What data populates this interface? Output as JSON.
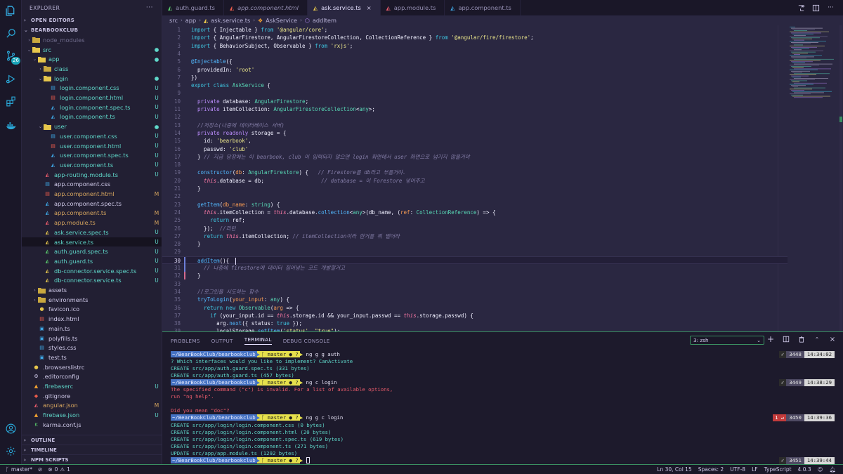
{
  "activity_bar": {
    "items": [
      "explorer-icon",
      "search-icon",
      "source-control-icon",
      "run-debug-icon",
      "extensions-icon",
      "docker-icon"
    ],
    "source_control_badge": "26",
    "bottom": [
      "account-icon",
      "settings-gear-icon"
    ]
  },
  "sidebar": {
    "title": "EXPLORER",
    "more": "···",
    "open_editors": "OPEN EDITORS",
    "project": "BEARBOOKCLUB",
    "tree": [
      {
        "name": "node_modules",
        "indent": 1,
        "type": "folder",
        "twisty": "›",
        "status": "",
        "color": "#6e6a8a",
        "icon": "folder-icon"
      },
      {
        "name": "src",
        "indent": 1,
        "type": "folder",
        "twisty": "⌄",
        "status": "●",
        "color": "#5fd7c9",
        "icon": "folder-open-icon"
      },
      {
        "name": "app",
        "indent": 2,
        "type": "folder",
        "twisty": "⌄",
        "status": "●",
        "color": "#5fd7c9",
        "icon": "folder-open-icon"
      },
      {
        "name": "class",
        "indent": 3,
        "type": "folder",
        "twisty": "›",
        "status": "",
        "color": "#5fd7c9",
        "icon": "folder-icon"
      },
      {
        "name": "login",
        "indent": 3,
        "type": "folder",
        "twisty": "⌄",
        "status": "●",
        "color": "#5fd7c9",
        "icon": "folder-open-icon"
      },
      {
        "name": "login.component.css",
        "indent": 4,
        "type": "css",
        "status": "U",
        "color": "#5fd7c9",
        "icon": "css-file-icon"
      },
      {
        "name": "login.component.html",
        "indent": 4,
        "type": "html",
        "status": "U",
        "color": "#5fd7c9",
        "icon": "html-file-icon"
      },
      {
        "name": "login.component.spec.ts",
        "indent": 4,
        "type": "spec",
        "status": "U",
        "color": "#5fd7c9",
        "icon": "angular-spec-icon"
      },
      {
        "name": "login.component.ts",
        "indent": 4,
        "type": "ts",
        "status": "U",
        "color": "#5fd7c9",
        "icon": "angular-ts-icon"
      },
      {
        "name": "user",
        "indent": 3,
        "type": "folder",
        "twisty": "⌄",
        "status": "●",
        "color": "#5fd7c9",
        "icon": "folder-open-icon"
      },
      {
        "name": "user.component.css",
        "indent": 4,
        "type": "css",
        "status": "U",
        "color": "#5fd7c9",
        "icon": "css-file-icon"
      },
      {
        "name": "user.component.html",
        "indent": 4,
        "type": "html",
        "status": "U",
        "color": "#5fd7c9",
        "icon": "html-file-icon"
      },
      {
        "name": "user.component.spec.ts",
        "indent": 4,
        "type": "spec",
        "status": "U",
        "color": "#5fd7c9",
        "icon": "angular-spec-icon"
      },
      {
        "name": "user.component.ts",
        "indent": 4,
        "type": "ts",
        "status": "U",
        "color": "#5fd7c9",
        "icon": "angular-ts-icon"
      },
      {
        "name": "app-routing.module.ts",
        "indent": 3,
        "type": "mod",
        "status": "U",
        "color": "#5fd7c9",
        "icon": "angular-module-icon"
      },
      {
        "name": "app.component.css",
        "indent": 3,
        "type": "css",
        "status": "",
        "color": "#cfc9e8",
        "icon": "css-file-icon"
      },
      {
        "name": "app.component.html",
        "indent": 3,
        "type": "html",
        "status": "M",
        "color": "#d7a65f",
        "icon": "html-file-icon"
      },
      {
        "name": "app.component.spec.ts",
        "indent": 3,
        "type": "spec",
        "status": "",
        "color": "#cfc9e8",
        "icon": "angular-spec-icon"
      },
      {
        "name": "app.component.ts",
        "indent": 3,
        "type": "ts",
        "status": "M",
        "color": "#d7a65f",
        "icon": "angular-ts-icon"
      },
      {
        "name": "app.module.ts",
        "indent": 3,
        "type": "mod",
        "status": "M",
        "color": "#d7a65f",
        "icon": "angular-module-icon"
      },
      {
        "name": "ask.service.spec.ts",
        "indent": 3,
        "type": "svcspec",
        "status": "U",
        "color": "#5fd7c9",
        "icon": "service-spec-icon"
      },
      {
        "name": "ask.service.ts",
        "indent": 3,
        "type": "svc",
        "status": "U",
        "color": "#5fd7c9",
        "icon": "service-file-icon",
        "selected": true
      },
      {
        "name": "auth.guard.spec.ts",
        "indent": 3,
        "type": "guard",
        "status": "U",
        "color": "#5fd7c9",
        "icon": "guard-spec-icon"
      },
      {
        "name": "auth.guard.ts",
        "indent": 3,
        "type": "guard",
        "status": "U",
        "color": "#5fd7c9",
        "icon": "guard-file-icon"
      },
      {
        "name": "db-connector.service.spec.ts",
        "indent": 3,
        "type": "svcspec",
        "status": "U",
        "color": "#5fd7c9",
        "icon": "service-spec-icon"
      },
      {
        "name": "db-connector.service.ts",
        "indent": 3,
        "type": "svc",
        "status": "U",
        "color": "#5fd7c9",
        "icon": "service-file-icon"
      },
      {
        "name": "assets",
        "indent": 2,
        "type": "folder",
        "twisty": "›",
        "status": "",
        "color": "#cfc9e8",
        "icon": "folder-icon"
      },
      {
        "name": "environments",
        "indent": 2,
        "type": "folder",
        "twisty": "›",
        "status": "",
        "color": "#cfc9e8",
        "icon": "folder-icon"
      },
      {
        "name": "favicon.ico",
        "indent": 2,
        "type": "fav",
        "status": "",
        "color": "#cfc9e8",
        "icon": "favicon-file-icon"
      },
      {
        "name": "index.html",
        "indent": 2,
        "type": "html",
        "status": "",
        "color": "#cfc9e8",
        "icon": "html-file-icon"
      },
      {
        "name": "main.ts",
        "indent": 2,
        "type": "tsplain",
        "status": "",
        "color": "#cfc9e8",
        "icon": "typescript-file-icon"
      },
      {
        "name": "polyfills.ts",
        "indent": 2,
        "type": "tsplain",
        "status": "",
        "color": "#cfc9e8",
        "icon": "typescript-file-icon"
      },
      {
        "name": "styles.css",
        "indent": 2,
        "type": "css",
        "status": "",
        "color": "#cfc9e8",
        "icon": "css-file-icon"
      },
      {
        "name": "test.ts",
        "indent": 2,
        "type": "tsplain",
        "status": "",
        "color": "#cfc9e8",
        "icon": "typescript-file-icon"
      },
      {
        "name": ".browserslistrc",
        "indent": 1,
        "type": "dot",
        "status": "",
        "color": "#cfc9e8",
        "icon": "browserslist-file-icon"
      },
      {
        "name": ".editorconfig",
        "indent": 1,
        "type": "gear",
        "status": "",
        "color": "#cfc9e8",
        "icon": "editorconfig-file-icon"
      },
      {
        "name": ".firebaserc",
        "indent": 1,
        "type": "fire",
        "status": "U",
        "color": "#5fd7c9",
        "icon": "firebase-file-icon"
      },
      {
        "name": ".gitignore",
        "indent": 1,
        "type": "git",
        "status": "",
        "color": "#cfc9e8",
        "icon": "git-file-icon"
      },
      {
        "name": "angular.json",
        "indent": 1,
        "type": "ang",
        "status": "M",
        "color": "#d7a65f",
        "icon": "angular-json-icon"
      },
      {
        "name": "firebase.json",
        "indent": 1,
        "type": "fire",
        "status": "U",
        "color": "#5fd7c9",
        "icon": "firebase-file-icon"
      },
      {
        "name": "karma.conf.js",
        "indent": 1,
        "type": "karma",
        "status": "",
        "color": "#cfc9e8",
        "icon": "karma-file-icon"
      }
    ],
    "outline": "OUTLINE",
    "timeline": "TIMELINE",
    "npm_scripts": "NPM SCRIPTS"
  },
  "tabs": [
    {
      "label": "auth.guard.ts",
      "italic": false,
      "active": false,
      "icon": "guard-file-icon",
      "icolor": "#58c76b"
    },
    {
      "label": "app.component.html",
      "italic": true,
      "active": false,
      "icon": "html-file-icon",
      "icolor": "#ec5c4c"
    },
    {
      "label": "ask.service.ts",
      "italic": false,
      "active": true,
      "icon": "service-file-icon",
      "icolor": "#e6c64c",
      "close": "×"
    },
    {
      "label": "app.module.ts",
      "italic": false,
      "active": false,
      "icon": "angular-module-icon",
      "icolor": "#ec5c6c"
    },
    {
      "label": "app.component.ts",
      "italic": false,
      "active": false,
      "icon": "angular-ts-icon",
      "icolor": "#3ea7e6"
    }
  ],
  "breadcrumb": [
    "src",
    "app",
    "ask.service.ts",
    "AskService",
    "addItem"
  ],
  "editor": {
    "current_line": 30,
    "lines": [
      [
        [
          "kw",
          "import"
        ],
        [
          "pr",
          " { Injectable } "
        ],
        [
          "kw",
          "from"
        ],
        [
          "st2",
          " '@angular/core'"
        ],
        [
          "pr",
          ";"
        ]
      ],
      [
        [
          "kw",
          "import"
        ],
        [
          "pr",
          " { AngularFirestore, AngularFirestoreCollection, CollectionReference } "
        ],
        [
          "kw",
          "from"
        ],
        [
          "st2",
          " '@angular/fire/firestore'"
        ],
        [
          "pr",
          ";"
        ]
      ],
      [
        [
          "kw",
          "import"
        ],
        [
          "pr",
          " { BehaviorSubject, Observable } "
        ],
        [
          "kw",
          "from"
        ],
        [
          "st2",
          " 'rxjs'"
        ],
        [
          "pr",
          ";"
        ]
      ],
      [],
      [
        [
          "fn",
          "@Injectable"
        ],
        [
          "pr",
          "({"
        ]
      ],
      [
        [
          "pr",
          "  providedIn: "
        ],
        [
          "st2",
          "'root'"
        ]
      ],
      [
        [
          "pr",
          "})"
        ]
      ],
      [
        [
          "kw",
          "export class "
        ],
        [
          "ty",
          "AskService"
        ],
        [
          "pr",
          " {"
        ]
      ],
      [],
      [
        [
          "kp",
          "  private "
        ],
        [
          "pr",
          "database: "
        ],
        [
          "ty",
          "AngularFirestore"
        ],
        [
          "pr",
          ";"
        ]
      ],
      [
        [
          "kp",
          "  private "
        ],
        [
          "pr",
          "itemCollection: "
        ],
        [
          "ty",
          "AngularFirestoreCollection"
        ],
        [
          "pr",
          "<"
        ],
        [
          "ty",
          "any"
        ],
        [
          "pr",
          ">;"
        ]
      ],
      [],
      [
        [
          "cm",
          "  //저장소(나중에 데이터베이스 서버)"
        ]
      ],
      [
        [
          "kp",
          "  private readonly "
        ],
        [
          "pr",
          "storage = {"
        ]
      ],
      [
        [
          "pr",
          "    id: "
        ],
        [
          "st2",
          "'bearbook'"
        ],
        [
          "pr",
          ","
        ]
      ],
      [
        [
          "pr",
          "    passwd: "
        ],
        [
          "st2",
          "'club'"
        ]
      ],
      [
        [
          "pr",
          "  } "
        ],
        [
          "cm",
          "// 지금 당장에는 이 bearbook, club 이 입력되지 않으면 login 화면에서 user 화면으로 넘기지 않을거야"
        ]
      ],
      [],
      [
        [
          "fn",
          "  constructor"
        ],
        [
          "pr",
          "("
        ],
        [
          "pa",
          "db"
        ],
        [
          "pr",
          ": "
        ],
        [
          "ty",
          "AngularFirestore"
        ],
        [
          "pr",
          ") {   "
        ],
        [
          "cm",
          "// Firestore를 db라고 부를거야."
        ]
      ],
      [
        [
          "th",
          "    this"
        ],
        [
          "pr",
          ".database = db;                  "
        ],
        [
          "cm",
          "// database = 이 Forestore 넣어주고"
        ]
      ],
      [
        [
          "pr",
          "  }"
        ]
      ],
      [],
      [
        [
          "fn",
          "  getItem"
        ],
        [
          "pr",
          "("
        ],
        [
          "pa",
          "db_name"
        ],
        [
          "pr",
          ": "
        ],
        [
          "ty",
          "string"
        ],
        [
          "pr",
          ") {"
        ]
      ],
      [
        [
          "th",
          "    this"
        ],
        [
          "pr",
          ".itemCollection = "
        ],
        [
          "th",
          "this"
        ],
        [
          "pr",
          ".database."
        ],
        [
          "fn",
          "collection"
        ],
        [
          "pr",
          "<"
        ],
        [
          "ty",
          "any"
        ],
        [
          "pr",
          ">(db_name, ("
        ],
        [
          "pa",
          "ref"
        ],
        [
          "pr",
          ": "
        ],
        [
          "ty",
          "CollectionReference"
        ],
        [
          "pr",
          ") => {"
        ]
      ],
      [
        [
          "kw",
          "      return "
        ],
        [
          "pr",
          "ref;"
        ]
      ],
      [
        [
          "pr",
          "    });  "
        ],
        [
          "cm",
          "//리턴"
        ]
      ],
      [
        [
          "kw",
          "    return "
        ],
        [
          "th",
          "this"
        ],
        [
          "pr",
          ".itemCollection; "
        ],
        [
          "cm",
          "// itemCollection이라 한거를 뭐 뱉어라"
        ]
      ],
      [
        [
          "pr",
          "  }"
        ]
      ],
      [],
      [
        [
          "fn",
          "  addItem"
        ],
        [
          "pr",
          "(){  "
        ]
      ],
      [
        [
          "cm",
          "    // 나중에 firestore에 데이터 집어넣는 코드 개발할거고"
        ]
      ],
      [
        [
          "pr",
          "  }"
        ]
      ],
      [],
      [
        [
          "cm",
          "  //로그인을 시도하는 함수"
        ]
      ],
      [
        [
          "fn",
          "  tryToLogin"
        ],
        [
          "pr",
          "("
        ],
        [
          "pa",
          "your_input"
        ],
        [
          "pr",
          ": "
        ],
        [
          "ty",
          "any"
        ],
        [
          "pr",
          ") {"
        ]
      ],
      [
        [
          "kw",
          "    return new "
        ],
        [
          "ty",
          "Observable"
        ],
        [
          "pr",
          "("
        ],
        [
          "pa",
          "arg"
        ],
        [
          "pr",
          " => {"
        ]
      ],
      [
        [
          "kw",
          "      if "
        ],
        [
          "pr",
          "(your_input.id == "
        ],
        [
          "th",
          "this"
        ],
        [
          "pr",
          ".storage.id && your_input.passwd == "
        ],
        [
          "th",
          "this"
        ],
        [
          "pr",
          ".storage.passwd) {"
        ]
      ],
      [
        [
          "pr",
          "        arg."
        ],
        [
          "fn",
          "next"
        ],
        [
          "pr",
          "({ status: "
        ],
        [
          "kw",
          "true"
        ],
        [
          "pr",
          " });"
        ]
      ],
      [
        [
          "pr",
          "        localStorage."
        ],
        [
          "fn",
          "setItem"
        ],
        [
          "pr",
          "("
        ],
        [
          "st2",
          "'status'"
        ],
        [
          "pr",
          ", "
        ],
        [
          "st2",
          "\"true\""
        ],
        [
          "pr",
          ");"
        ]
      ]
    ]
  },
  "panel": {
    "tabs": [
      "PROBLEMS",
      "OUTPUT",
      "TERMINAL",
      "DEBUG CONSOLE"
    ],
    "active": "TERMINAL",
    "shell": "3: zsh",
    "lines": [
      {
        "type": "prompt",
        "path": "~/BearBookClub/bearbookclub",
        "git": "ᚴ master ● ?",
        "cmd": "ng g g auth",
        "status": "✓",
        "count": "3448",
        "time": "14:34:02"
      },
      {
        "type": "out",
        "cls": "t-cyan",
        "text": "? Which interfaces would you like to implement? CanActivate"
      },
      {
        "type": "out",
        "cls": "t-cyan",
        "text": "CREATE src/app/auth.guard.spec.ts (331 bytes)"
      },
      {
        "type": "out",
        "cls": "t-cyan",
        "text": "CREATE src/app/auth.guard.ts (457 bytes)"
      },
      {
        "type": "prompt",
        "path": "~/BearBookClub/bearbookclub",
        "git": "ᚴ master ● ?",
        "cmd": "ng c login",
        "status": "✓",
        "count": "3449",
        "time": "14:38:29"
      },
      {
        "type": "out",
        "cls": "t-red",
        "text": "The specified command (\"c\") is invalid. For a list of available options,"
      },
      {
        "type": "out",
        "cls": "t-red",
        "text": "run \"ng help\"."
      },
      {
        "type": "out",
        "cls": "t-red",
        "text": ""
      },
      {
        "type": "out",
        "cls": "t-red",
        "text": "Did you mean \"doc\"?"
      },
      {
        "type": "prompt",
        "path": "~/BearBookClub/bearbookclub",
        "git": "ᚴ master ● ?",
        "cmd": "ng g c login",
        "status": "1 ↵",
        "err": true,
        "count": "3450",
        "time": "14:39:36"
      },
      {
        "type": "out",
        "cls": "t-cyan",
        "text": "CREATE src/app/login/login.component.css (0 bytes)"
      },
      {
        "type": "out",
        "cls": "t-cyan",
        "text": "CREATE src/app/login/login.component.html (20 bytes)"
      },
      {
        "type": "out",
        "cls": "t-cyan",
        "text": "CREATE src/app/login/login.component.spec.ts (619 bytes)"
      },
      {
        "type": "out",
        "cls": "t-cyan",
        "text": "CREATE src/app/login/login.component.ts (271 bytes)"
      },
      {
        "type": "out",
        "cls": "t-cyan",
        "text": "UPDATE src/app/app.module.ts (1292 bytes)"
      },
      {
        "type": "prompt",
        "path": "~/BearBookClub/bearbookclub",
        "git": "ᚴ master ● ?",
        "cmd": "",
        "cursor": true,
        "status": "✓",
        "count": "3451",
        "time": "14:39:44"
      }
    ]
  },
  "status_bar": {
    "branch": "master*",
    "sync": "⊘",
    "errors": "0",
    "warnings": "1",
    "cursor": "Ln 30, Col 15",
    "spaces": "Spaces: 2",
    "encoding": "UTF-8",
    "eol": "LF",
    "language": "TypeScript",
    "version": "4.0.3"
  }
}
